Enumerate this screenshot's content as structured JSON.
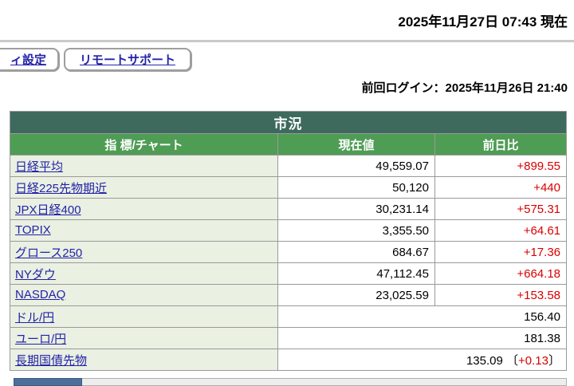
{
  "header": {
    "datetime": "2025年11月27日 07:43 現在",
    "last_login": "前回ログイン：2025年11月26日 21:40"
  },
  "toolbar": {
    "settings_button_label": "ィ設定",
    "remote_support_button_label": "リモートサポート"
  },
  "market_table": {
    "title": "市況",
    "columns": [
      "指 標/チャート",
      "現在値",
      "前日比"
    ],
    "rows": [
      {
        "label": "日経平均",
        "value": "49,559.07",
        "change": "+899.55"
      },
      {
        "label": "日経225先物期近",
        "value": "50,120",
        "change": "+440"
      },
      {
        "label": "JPX日経400",
        "value": "30,231.14",
        "change": "+575.31"
      },
      {
        "label": "TOPIX",
        "value": "3,355.50",
        "change": "+64.61"
      },
      {
        "label": "グロース250",
        "value": "684.67",
        "change": "+17.36"
      },
      {
        "label": "NYダウ",
        "value": "47,112.45",
        "change": "+664.18"
      },
      {
        "label": "NASDAQ",
        "value": "23,025.59",
        "change": "+153.58"
      },
      {
        "label": "ドル/円",
        "value": "156.40",
        "merged": true
      },
      {
        "label": "ユーロ/円",
        "value": "181.38",
        "merged": true
      },
      {
        "label": "長期国債先物",
        "value": "135.09",
        "merged": true,
        "bracket_open": "〔",
        "change_in_brackets": "+0.13",
        "bracket_close": "〕"
      }
    ]
  },
  "colors": {
    "table_title_bg": "#3e6a5e",
    "table_header_bg": "#4f9c55",
    "label_cell_bg": "#eaf0e2",
    "link_text": "#2323a8",
    "positive_change": "#d90000"
  }
}
